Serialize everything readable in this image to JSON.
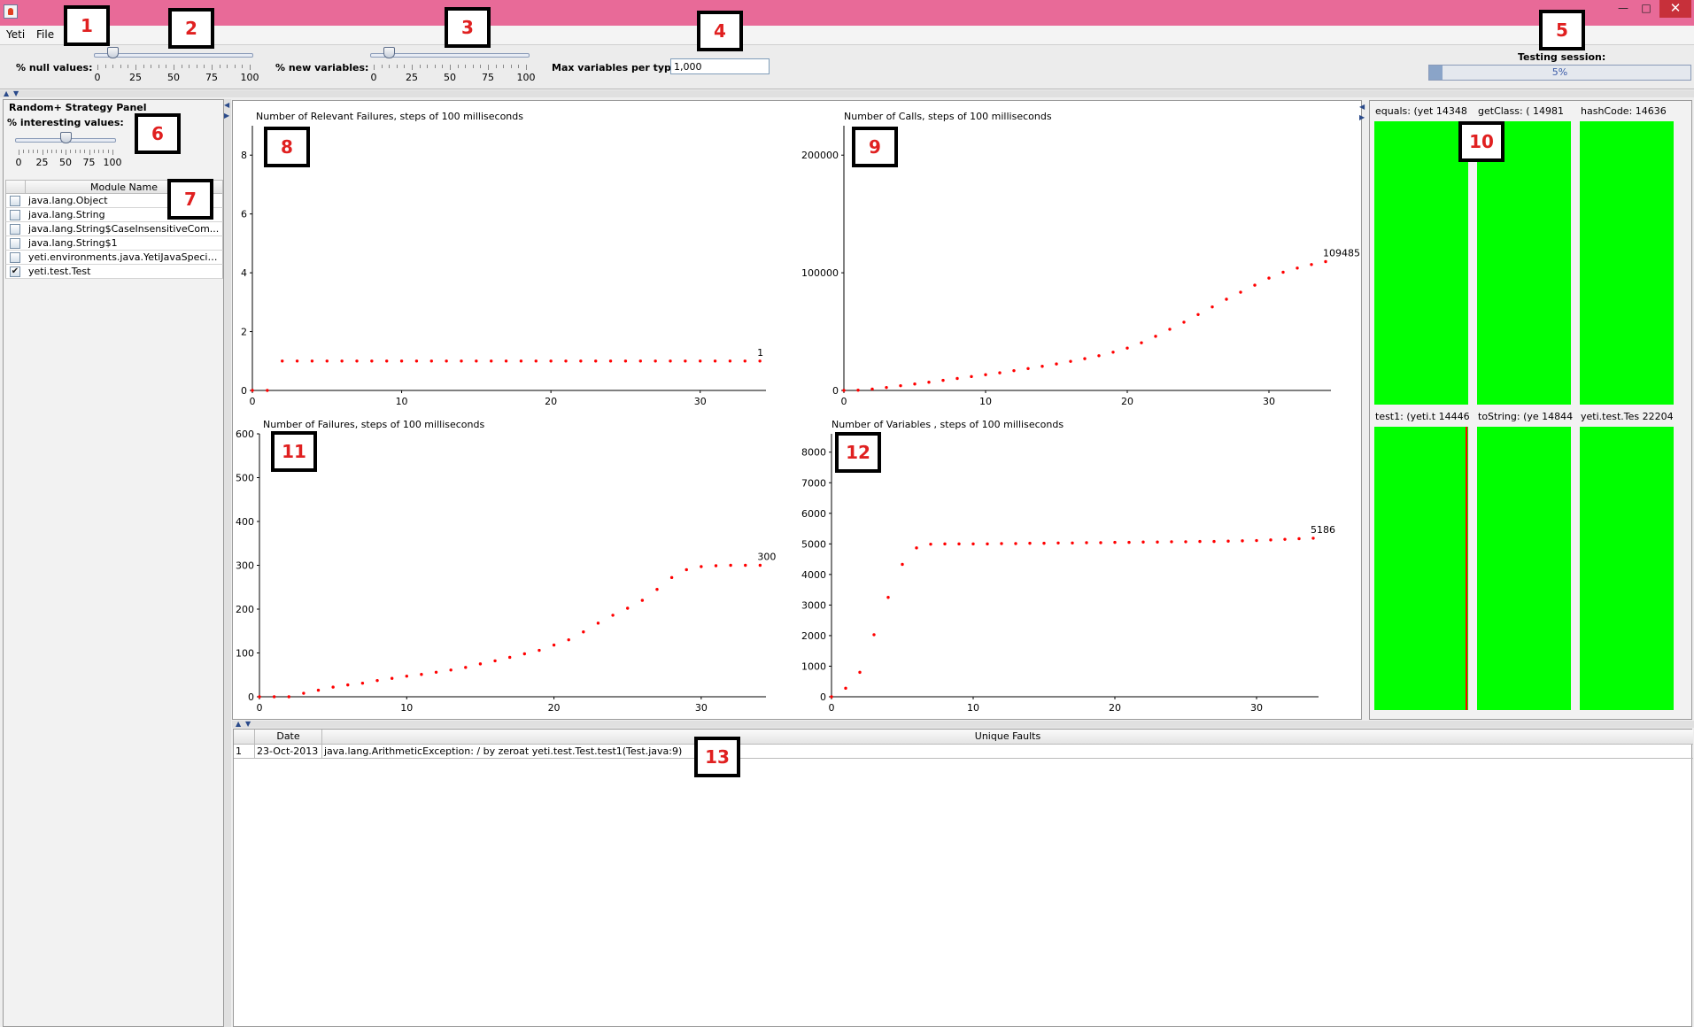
{
  "menu": {
    "yeti": "Yeti",
    "file": "File"
  },
  "toolbar": {
    "null_values_label": "% null values:",
    "null_values_value": 10,
    "new_variables_label": "% new variables:",
    "new_variables_value": 10,
    "slider_ticks": [
      "0",
      "25",
      "50",
      "75",
      "100"
    ],
    "max_vars_label": "Max variables per type:",
    "max_vars_value": "1,000",
    "testing_session_label": "Testing session:",
    "progress_text": "5%",
    "progress_value": 5
  },
  "strategy": {
    "title": "Random+ Strategy Panel",
    "interesting_label": "% interesting values:",
    "interesting_value": 50,
    "slider_ticks": [
      "0",
      "25",
      "50",
      "75",
      "100"
    ]
  },
  "modules": {
    "header": "Module Name",
    "items": [
      {
        "name": "java.lang.Object",
        "checked": false
      },
      {
        "name": "java.lang.String",
        "checked": false
      },
      {
        "name": "java.lang.String$CaseInsensitiveCom...",
        "checked": false
      },
      {
        "name": "java.lang.String$1",
        "checked": false
      },
      {
        "name": "yeti.environments.java.YetiJavaSpecifi...",
        "checked": false
      },
      {
        "name": "yeti.test.Test",
        "checked": true
      }
    ]
  },
  "chart_data": [
    {
      "type": "scatter",
      "title": "Number of Relevant Failures, steps of 100 milliseconds",
      "x": [
        0,
        1,
        2,
        3,
        4,
        5,
        6,
        7,
        8,
        9,
        10,
        11,
        12,
        13,
        14,
        15,
        16,
        17,
        18,
        19,
        20,
        21,
        22,
        23,
        24,
        25,
        26,
        27,
        28,
        29,
        30,
        31,
        32,
        33,
        34
      ],
      "y": [
        0,
        0,
        1,
        1,
        1,
        1,
        1,
        1,
        1,
        1,
        1,
        1,
        1,
        1,
        1,
        1,
        1,
        1,
        1,
        1,
        1,
        1,
        1,
        1,
        1,
        1,
        1,
        1,
        1,
        1,
        1,
        1,
        1,
        1,
        1
      ],
      "xlim": [
        0,
        35
      ],
      "ylim": [
        0,
        9
      ],
      "yticks": [
        0,
        2,
        4,
        6,
        8
      ],
      "xticks": [
        0,
        10,
        20,
        30
      ],
      "last_label": "1",
      "color": "#ff0000"
    },
    {
      "type": "scatter",
      "title": "Number of Calls, steps of 100 milliseconds",
      "x": [
        0,
        1,
        2,
        3,
        4,
        5,
        6,
        7,
        8,
        9,
        10,
        11,
        12,
        13,
        14,
        15,
        16,
        17,
        18,
        19,
        20,
        21,
        22,
        23,
        24,
        25,
        26,
        27,
        28,
        29,
        30,
        31,
        32,
        33,
        34
      ],
      "y": [
        0,
        200,
        1200,
        2500,
        4000,
        5500,
        7000,
        8600,
        10200,
        11800,
        13400,
        15000,
        16800,
        18600,
        20500,
        22500,
        24700,
        27000,
        29500,
        32500,
        36000,
        40500,
        46000,
        52000,
        58000,
        64500,
        71000,
        77500,
        83500,
        89500,
        95500,
        100500,
        104000,
        107000,
        109485
      ],
      "xlim": [
        0,
        35
      ],
      "ylim": [
        0,
        225000
      ],
      "yticks": [
        0,
        100000,
        200000
      ],
      "xticks": [
        0,
        10,
        20,
        30
      ],
      "last_label": "109485",
      "color": "#ff0000"
    },
    {
      "type": "scatter",
      "title": "Number of Failures, steps of 100 milliseconds",
      "x": [
        0,
        1,
        2,
        3,
        4,
        5,
        6,
        7,
        8,
        9,
        10,
        11,
        12,
        13,
        14,
        15,
        16,
        17,
        18,
        19,
        20,
        21,
        22,
        23,
        24,
        25,
        26,
        27,
        28,
        29,
        30,
        31,
        32,
        33,
        34
      ],
      "y": [
        0,
        0,
        0,
        8,
        15,
        22,
        27,
        31,
        37,
        42,
        47,
        51,
        56,
        61,
        67,
        75,
        82,
        90,
        98,
        106,
        118,
        130,
        148,
        168,
        186,
        202,
        220,
        245,
        272,
        290,
        297,
        299,
        300,
        300,
        300
      ],
      "xlim": [
        0,
        35
      ],
      "ylim": [
        0,
        600
      ],
      "yticks": [
        0,
        100,
        200,
        300,
        400,
        500,
        600
      ],
      "xticks": [
        0,
        10,
        20,
        30
      ],
      "last_label": "300",
      "color": "#ff0000"
    },
    {
      "type": "scatter",
      "title": "Number of Variables , steps of 100 milliseconds",
      "x": [
        0,
        1,
        2,
        3,
        4,
        5,
        6,
        7,
        8,
        9,
        10,
        11,
        12,
        13,
        14,
        15,
        16,
        17,
        18,
        19,
        20,
        21,
        22,
        23,
        24,
        25,
        26,
        27,
        28,
        29,
        30,
        31,
        32,
        33,
        34
      ],
      "y": [
        0,
        280,
        800,
        2030,
        3250,
        4330,
        4870,
        4990,
        5000,
        5000,
        5000,
        5000,
        5010,
        5010,
        5020,
        5020,
        5030,
        5030,
        5040,
        5040,
        5050,
        5050,
        5060,
        5060,
        5070,
        5070,
        5080,
        5080,
        5090,
        5100,
        5110,
        5130,
        5150,
        5170,
        5186
      ],
      "xlim": [
        0,
        35
      ],
      "ylim": [
        0,
        8600
      ],
      "yticks": [
        0,
        1000,
        2000,
        3000,
        4000,
        5000,
        6000,
        7000,
        8000
      ],
      "xticks": [
        0,
        10,
        20,
        30
      ],
      "last_label": "5186",
      "color": "#ff0000"
    }
  ],
  "coverage": {
    "items": [
      {
        "title": "equals: (yet 14348",
        "coverage": 1.0
      },
      {
        "title": "getClass: ( 14981",
        "coverage": 1.0
      },
      {
        "title": "hashCode: 14636",
        "coverage": 1.0
      },
      {
        "title": "test1: (yeti.t 14446",
        "coverage": 1.0,
        "red_line_at": 0.99
      },
      {
        "title": "toString: (ye 14844",
        "coverage": 1.0
      },
      {
        "title": "yeti.test.Tes 22204",
        "coverage": 1.0
      }
    ],
    "fill_color": "#00ff00",
    "line_color": "#ff0000"
  },
  "faults": {
    "headers": [
      "",
      "Date",
      "Unique Faults"
    ],
    "rows": [
      [
        "1",
        "23-Oct-2013",
        "java.lang.ArithmeticException: / by zeroat yeti.test.Test.test1(Test.java:9)"
      ]
    ]
  },
  "annotations": [
    "1",
    "2",
    "3",
    "4",
    "5",
    "6",
    "7",
    "8",
    "9",
    "10",
    "11",
    "12",
    "13"
  ]
}
